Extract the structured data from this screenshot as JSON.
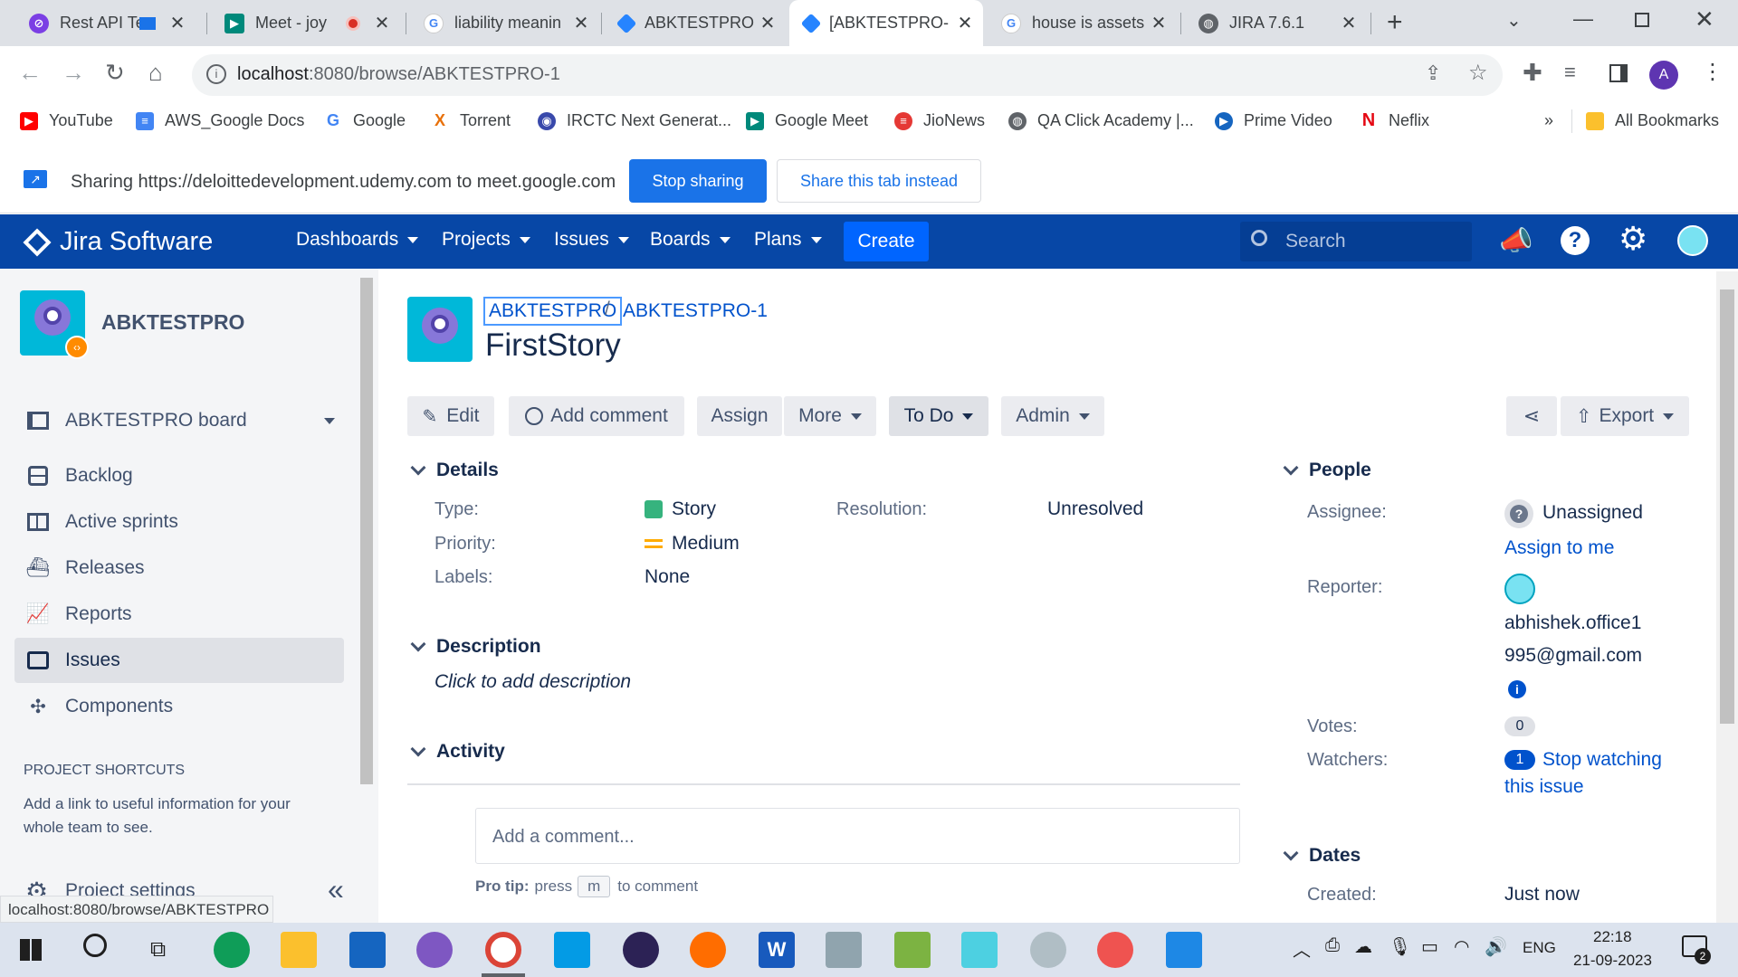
{
  "browser": {
    "tabs": [
      {
        "title": "Rest API Te",
        "active": false
      },
      {
        "title": "Meet - joy",
        "active": false
      },
      {
        "title": "liability meanin",
        "active": false
      },
      {
        "title": "ABKTESTPRO b",
        "active": false
      },
      {
        "title": "[ABKTESTPRO-",
        "active": true
      },
      {
        "title": "house is assets",
        "active": false
      },
      {
        "title": "JIRA 7.6.1",
        "active": false
      }
    ],
    "url_host": "localhost",
    "url_path": ":8080/browse/ABKTESTPRO-1",
    "profile_initial": "A",
    "bookmarks": [
      "YouTube",
      "AWS_Google Docs",
      "Google",
      "Torrent",
      "IRCTC Next Generat...",
      "Google Meet",
      "JioNews",
      "QA Click Academy |...",
      "Prime Video",
      "Neflix"
    ],
    "bookmarks_more": "»",
    "all_bookmarks": "All Bookmarks",
    "status_url": "localhost:8080/browse/ABKTESTPRO"
  },
  "sharing": {
    "message": "Sharing https://deloittedevelopment.udemy.com to meet.google.com",
    "stop_label": "Stop sharing",
    "share_tab_label": "Share this tab instead"
  },
  "jira_header": {
    "logo_text": "Jira Software",
    "nav": [
      "Dashboards",
      "Projects",
      "Issues",
      "Boards",
      "Plans"
    ],
    "create_label": "Create",
    "search_placeholder": "Search"
  },
  "sidebar": {
    "project_name": "ABKTESTPRO",
    "board_label": "ABKTESTPRO board",
    "items": [
      "Backlog",
      "Active sprints",
      "Releases",
      "Reports",
      "Issues",
      "Components"
    ],
    "selected_item": "Issues",
    "shortcuts_heading": "PROJECT SHORTCUTS",
    "shortcuts_text_1": "Add a link to useful information for your",
    "shortcuts_text_2": "whole team to see.",
    "settings_label": "Project settings",
    "collapse_glyph": "«"
  },
  "issue": {
    "breadcrumb_project": "ABKTESTPRO",
    "breadcrumb_sep": "/",
    "breadcrumb_issue": "ABKTESTPRO-1",
    "title": "FirstStory",
    "actions": {
      "edit": "Edit",
      "add_comment": "Add comment",
      "assign": "Assign",
      "more": "More",
      "status": "To Do",
      "admin": "Admin",
      "export": "Export"
    },
    "details_heading": "Details",
    "type_label": "Type:",
    "type_value": "Story",
    "priority_label": "Priority:",
    "priority_value": "Medium",
    "labels_label": "Labels:",
    "labels_value": "None",
    "resolution_label": "Resolution:",
    "resolution_value": "Unresolved",
    "description_heading": "Description",
    "description_placeholder": "Click to add description",
    "activity_heading": "Activity",
    "comment_placeholder": "Add a comment...",
    "protip_prefix": "Pro tip:",
    "protip_press": "press",
    "protip_key": "m",
    "protip_suffix": "to comment"
  },
  "people": {
    "heading": "People",
    "assignee_label": "Assignee:",
    "assignee_value": "Unassigned",
    "assign_to_me": "Assign to me",
    "reporter_label": "Reporter:",
    "reporter_line1": "abhishek.office1",
    "reporter_line2": "995@gmail.com",
    "votes_label": "Votes:",
    "votes_value": "0",
    "watchers_label": "Watchers:",
    "watchers_count": "1",
    "stop_watching_1": "Stop watching",
    "stop_watching_2": "this issue"
  },
  "dates": {
    "heading": "Dates",
    "created_label": "Created:",
    "created_value": "Just now"
  },
  "taskbar": {
    "language": "ENG",
    "time": "22:18",
    "date": "21-09-2023",
    "notification_count": "2"
  },
  "colors": {
    "jira_blue": "#0747a6",
    "create_blue": "#0065ff",
    "link_blue": "#0052cc",
    "share_button_blue": "#1a73e8",
    "medium_priority": "#ffab00",
    "story_green": "#36b37e"
  }
}
